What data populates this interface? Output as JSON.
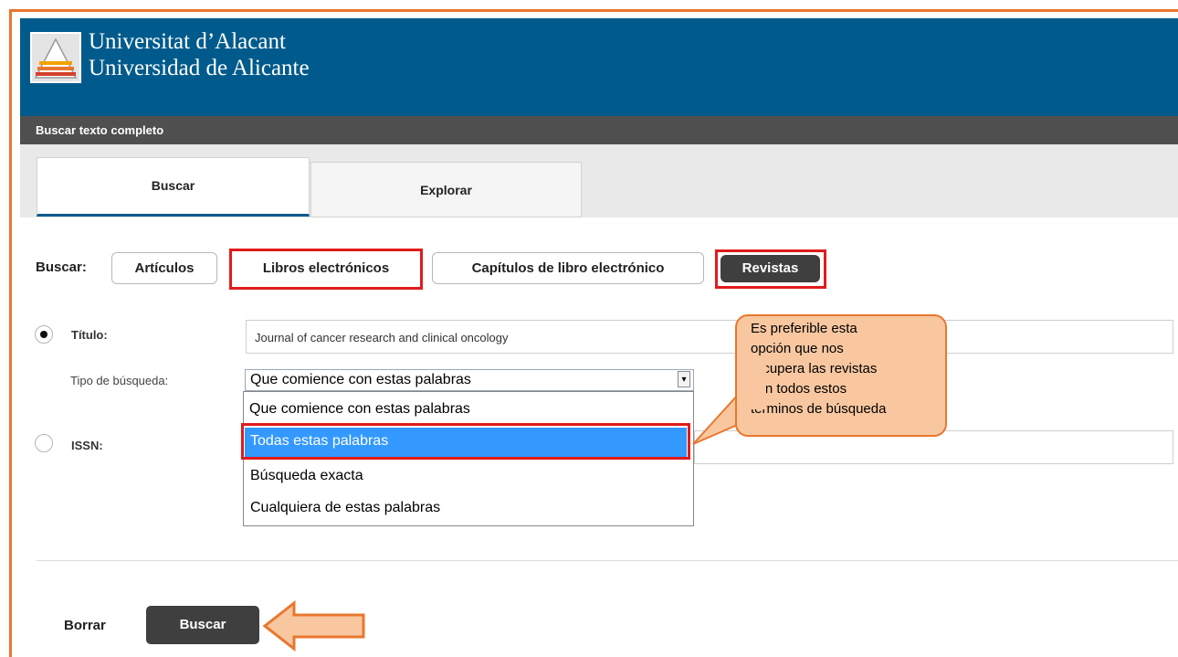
{
  "header": {
    "brand_line1": "Universitat d’Alacant",
    "brand_line2": "Universidad de Alicante"
  },
  "subbar": {
    "title": "Buscar texto completo"
  },
  "tabs": [
    {
      "label": "Buscar",
      "active": true
    },
    {
      "label": "Explorar",
      "active": false
    }
  ],
  "search_type": {
    "label": "Buscar:",
    "options": [
      "Artículos",
      "Libros electrónicos",
      "Capítulos de libro electrónico",
      "Revistas"
    ],
    "selected": "Revistas"
  },
  "title_field": {
    "label": "Título:",
    "value": "Journal of cancer research and clinical oncology",
    "selected": true
  },
  "match_type": {
    "label": "Tipo de búsqueda:",
    "value": "Que comience con estas palabras",
    "options": [
      "Que comience con estas palabras",
      "Todas estas palabras",
      "Búsqueda exacta",
      "Cualquiera de estas palabras"
    ],
    "highlighted": "Todas estas palabras"
  },
  "issn_field": {
    "label": "ISSN:",
    "value": "",
    "selected": false
  },
  "callout": {
    "lines": [
      "Es preferible esta",
      "opción que nos",
      "recupera las revistas",
      "con todos estos",
      "términos de búsqueda"
    ]
  },
  "actions": {
    "clear_label": "Borrar",
    "search_label": "Buscar"
  },
  "colors": {
    "header_blue": "#005b8c",
    "subbar_gray": "#4f4f4f",
    "annotation_orange": "#e8772e",
    "annotation_fill": "#f8c7a0",
    "highlight_red": "#e11b1b",
    "selected_option_blue": "#3399ff"
  }
}
